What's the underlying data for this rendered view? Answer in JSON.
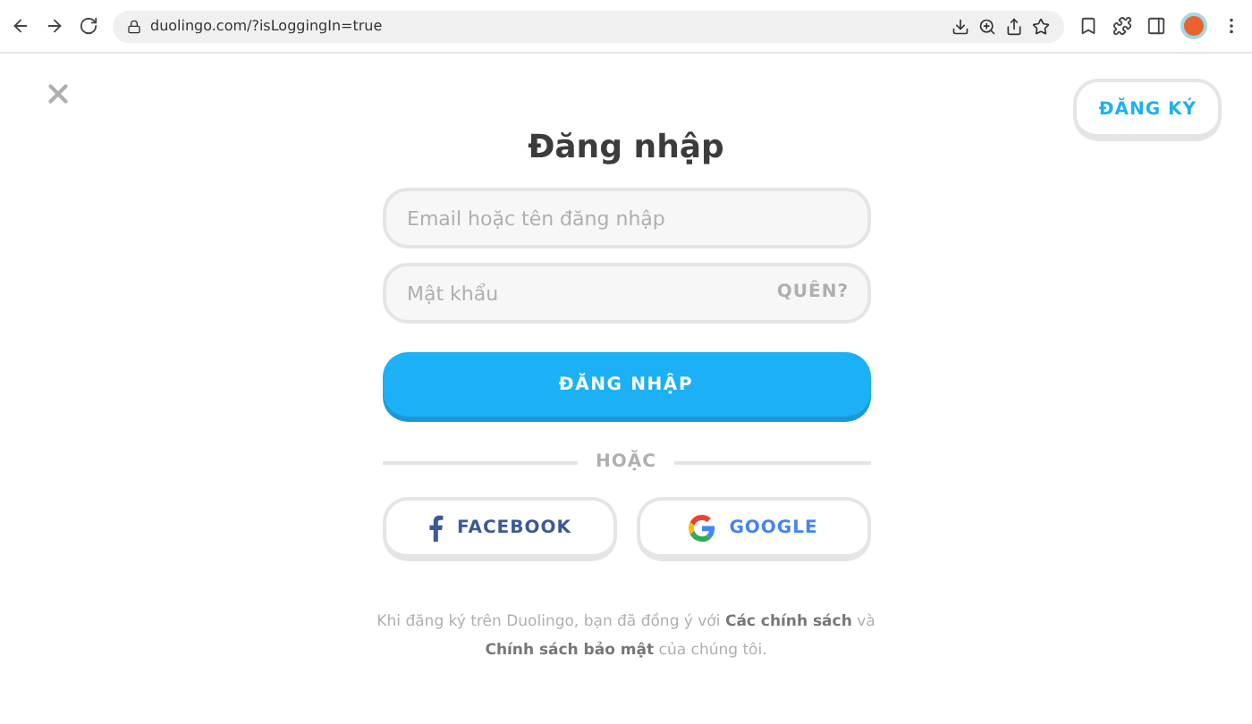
{
  "browser": {
    "url": "duolingo.com/?isLoggingIn=true"
  },
  "signup_button": "ĐĂNG KÝ",
  "title": "Đăng nhập",
  "fields": [
    {
      "placeholder": "Email hoặc tên đăng nhập"
    },
    {
      "placeholder": "Mật khẩu",
      "action": "QUÊN?"
    }
  ],
  "login_button": "ĐĂNG NHẬP",
  "divider": "HOẶC",
  "social_buttons": [
    {
      "kind": "facebook",
      "label": "FACEBOOK"
    },
    {
      "kind": "google",
      "label": "GOOGLE"
    }
  ],
  "legal": "Khi đăng ký trên Duolingo, bạn đã đồng ý với **Các chính sách** và **Chính sách bảo mật** của chúng tôi."
}
